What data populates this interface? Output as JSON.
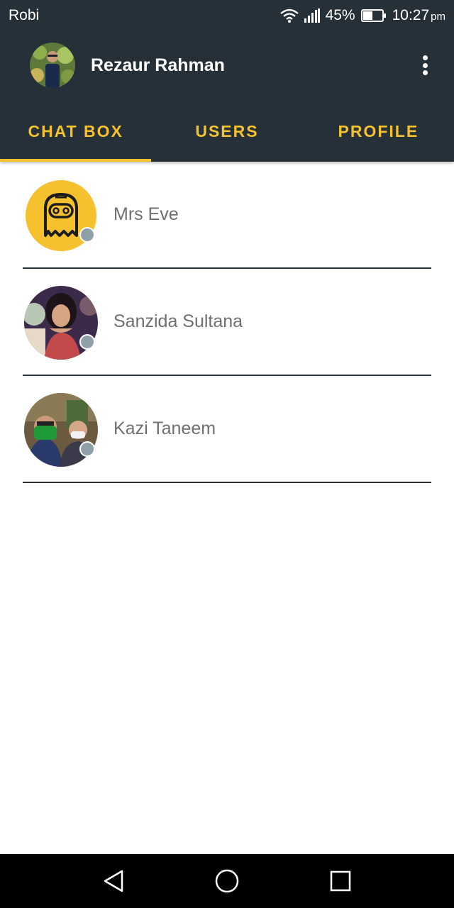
{
  "status_bar": {
    "carrier": "Robi",
    "battery_percent": "45%",
    "time": "10:27",
    "time_suffix": "pm",
    "icons": [
      "wifi-icon",
      "signal-icon",
      "battery-icon"
    ]
  },
  "app_bar": {
    "title": "Rezaur Rahman",
    "avatar_icon": "user-avatar",
    "menu_icon": "overflow-menu-icon"
  },
  "tabs": [
    {
      "label": "CHAT BOX",
      "active": true
    },
    {
      "label": "USERS",
      "active": false
    },
    {
      "label": "PROFILE",
      "active": false
    }
  ],
  "chats": [
    {
      "name": "Mrs Eve",
      "avatar": "ghost-icon",
      "status": "offline"
    },
    {
      "name": "Sanzida Sultana",
      "avatar": "photo-avatar",
      "status": "offline"
    },
    {
      "name": "Kazi Taneem",
      "avatar": "photo-avatar",
      "status": "offline"
    }
  ],
  "nav_bar": {
    "icons": [
      "back-icon",
      "home-icon",
      "recents-icon"
    ]
  },
  "colors": {
    "primary_dark": "#263038",
    "accent": "#f5c12e",
    "presence": "#8fa0a8",
    "name_text": "#6f6f6f"
  }
}
